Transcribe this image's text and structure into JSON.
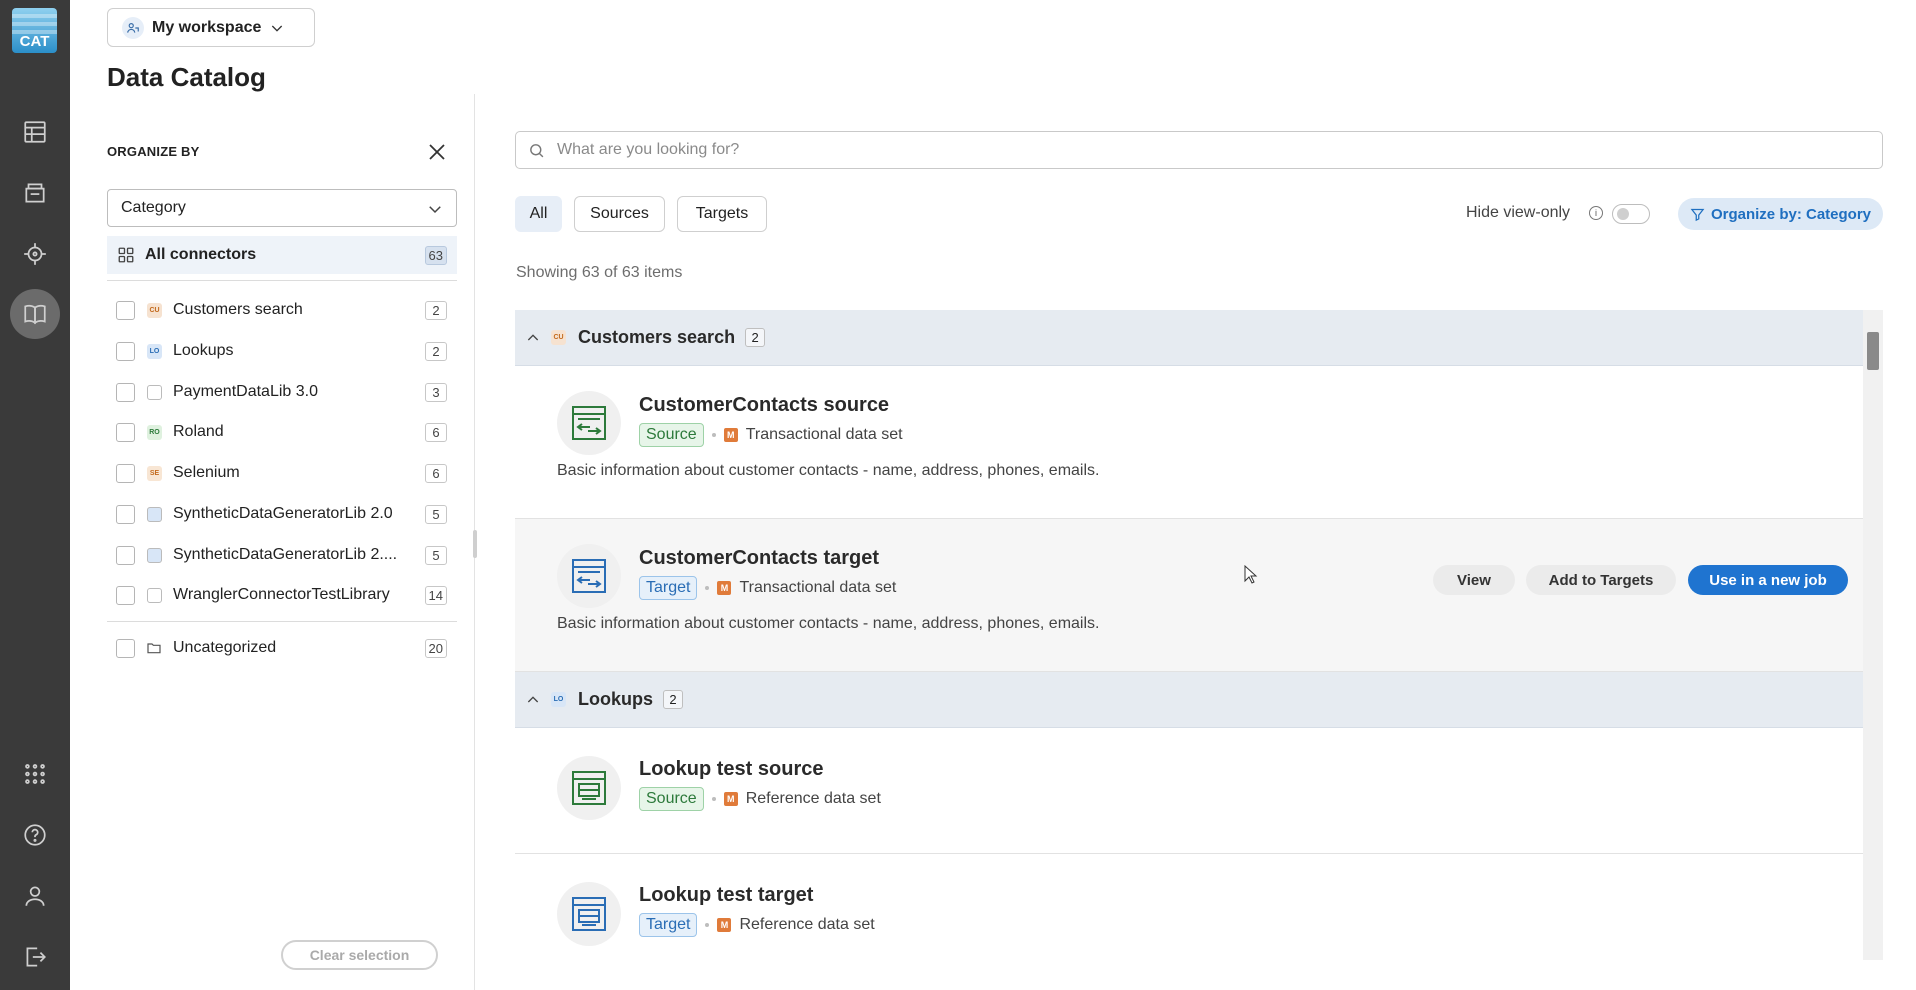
{
  "app": {
    "logo_text": "CAT"
  },
  "rail": {
    "items": [
      {
        "icon": "table-grid-icon"
      },
      {
        "icon": "archive-box-icon"
      },
      {
        "icon": "crosshair-icon"
      },
      {
        "icon": "book-open-icon",
        "active": true
      },
      {
        "icon": "apps-grid-icon"
      },
      {
        "icon": "help-icon"
      },
      {
        "icon": "user-icon"
      },
      {
        "icon": "logout-icon"
      }
    ]
  },
  "header": {
    "workspace_label": "My workspace",
    "page_title": "Data Catalog"
  },
  "organize": {
    "title": "ORGANIZE BY",
    "select_value": "Category",
    "all_connectors": {
      "label": "All connectors",
      "count": "63"
    },
    "categories": [
      {
        "label": "Customers search",
        "count": "2",
        "abbr": "CU",
        "color": "#f6e2d0",
        "fg": "#c36a1d"
      },
      {
        "label": "Lookups",
        "count": "2",
        "abbr": "LO",
        "color": "#d8e6f7",
        "fg": "#2a6db5"
      },
      {
        "label": "PaymentDataLib 3.0",
        "count": "3",
        "abbr": "",
        "color": "#ffffff",
        "fg": "#555"
      },
      {
        "label": "Roland",
        "count": "6",
        "abbr": "RO",
        "color": "#dff1df",
        "fg": "#2d7a3b"
      },
      {
        "label": "Selenium",
        "count": "6",
        "abbr": "SE",
        "color": "#f8e6d4",
        "fg": "#c36a1d"
      },
      {
        "label": "SyntheticDataGeneratorLib 2.0",
        "count": "5",
        "abbr": "",
        "color": "#d8e6f7",
        "fg": "#2a6db5"
      },
      {
        "label": "SyntheticDataGeneratorLib 2....",
        "count": "5",
        "abbr": "",
        "color": "#d8e6f7",
        "fg": "#2a6db5"
      },
      {
        "label": "WranglerConnectorTestLibrary",
        "count": "14",
        "abbr": "",
        "color": "#ffffff",
        "fg": "#555"
      }
    ],
    "uncategorized": {
      "label": "Uncategorized",
      "count": "20"
    },
    "clear_label": "Clear selection"
  },
  "search": {
    "placeholder": "What are you looking for?"
  },
  "filters": {
    "chips": [
      "All",
      "Sources",
      "Targets"
    ],
    "active": "All",
    "hide_view_only_label": "Hide view-only",
    "organize_button": "Organize by: Category"
  },
  "results": {
    "showing_text": "Showing 63 of 63 items",
    "groups": [
      {
        "name": "Customers search",
        "count": "2",
        "abbr": "CU",
        "entries": [
          {
            "name": "CustomerContacts source",
            "role": "Source",
            "type": "Transactional data set",
            "type_badge": "M",
            "description": "Basic information about customer contacts - name, address, phones, emails."
          },
          {
            "name": "CustomerContacts target",
            "role": "Target",
            "type": "Transactional data set",
            "type_badge": "M",
            "description": "Basic information about customer contacts - name, address, phones, emails.",
            "actions": [
              "View",
              "Add to Targets",
              "Use in a new job"
            ]
          }
        ]
      },
      {
        "name": "Lookups",
        "count": "2",
        "abbr": "LO",
        "entries": [
          {
            "name": "Lookup test source",
            "role": "Source",
            "type": "Reference data set",
            "type_badge": "M"
          },
          {
            "name": "Lookup test target",
            "role": "Target",
            "type": "Reference data set",
            "type_badge": "M"
          }
        ]
      }
    ]
  },
  "colors": {
    "accent": "#1f74d0",
    "rail_bg": "#3a3a3a",
    "source_green": "#2d7a3b",
    "target_blue": "#2a6db5",
    "group_header_bg": "#e6ebf1"
  }
}
